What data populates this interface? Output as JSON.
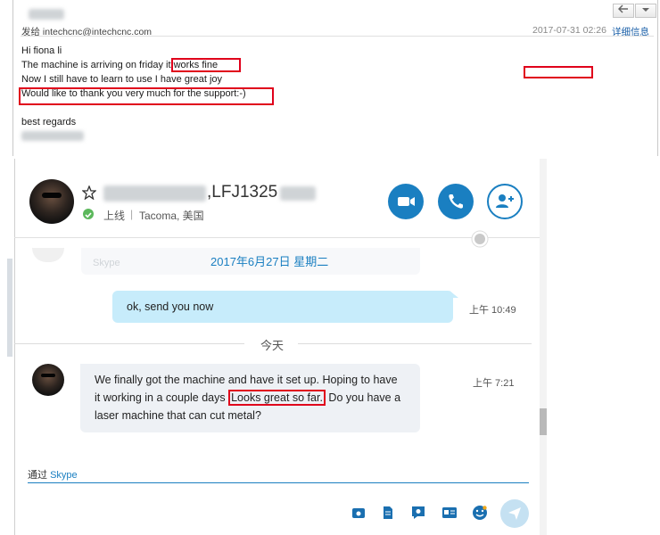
{
  "email": {
    "sender_label": "发给 intechcnc@intechcnc.com",
    "timestamp": "2017-07-31 02:26",
    "details_link": "详细信息",
    "lines": [
      "Hi fiona li",
      "The machine is arriving on friday it works fine",
      "Now I still have to learn to use I have great joy",
      "Would like to thank you very much for the support:-)",
      "",
      "best regards"
    ]
  },
  "skype": {
    "contact_name": ",LFJ1325",
    "status": "上线",
    "location": "Tacoma, 美国",
    "date_divider": "2017年6月27日 星期二",
    "faded_label": "Skype",
    "messages": [
      {
        "text": "ok, send you now",
        "time": "上午 10:49"
      }
    ],
    "today_divider": "今天",
    "incoming": {
      "part1": "We finally got the machine and have it set up. Hoping to have it working in a couple days",
      "highlight": "Looks great so far.",
      "part2": "Do you have a laser machine that can cut metal?",
      "time": "上午 7:21"
    },
    "via_label": "通过",
    "via_service": "Skype",
    "colors": {
      "accent": "#1a7fc1",
      "bubble_out": "#c7ecfb",
      "bubble_in": "#eef1f5",
      "highlight": "#e0001b"
    }
  }
}
